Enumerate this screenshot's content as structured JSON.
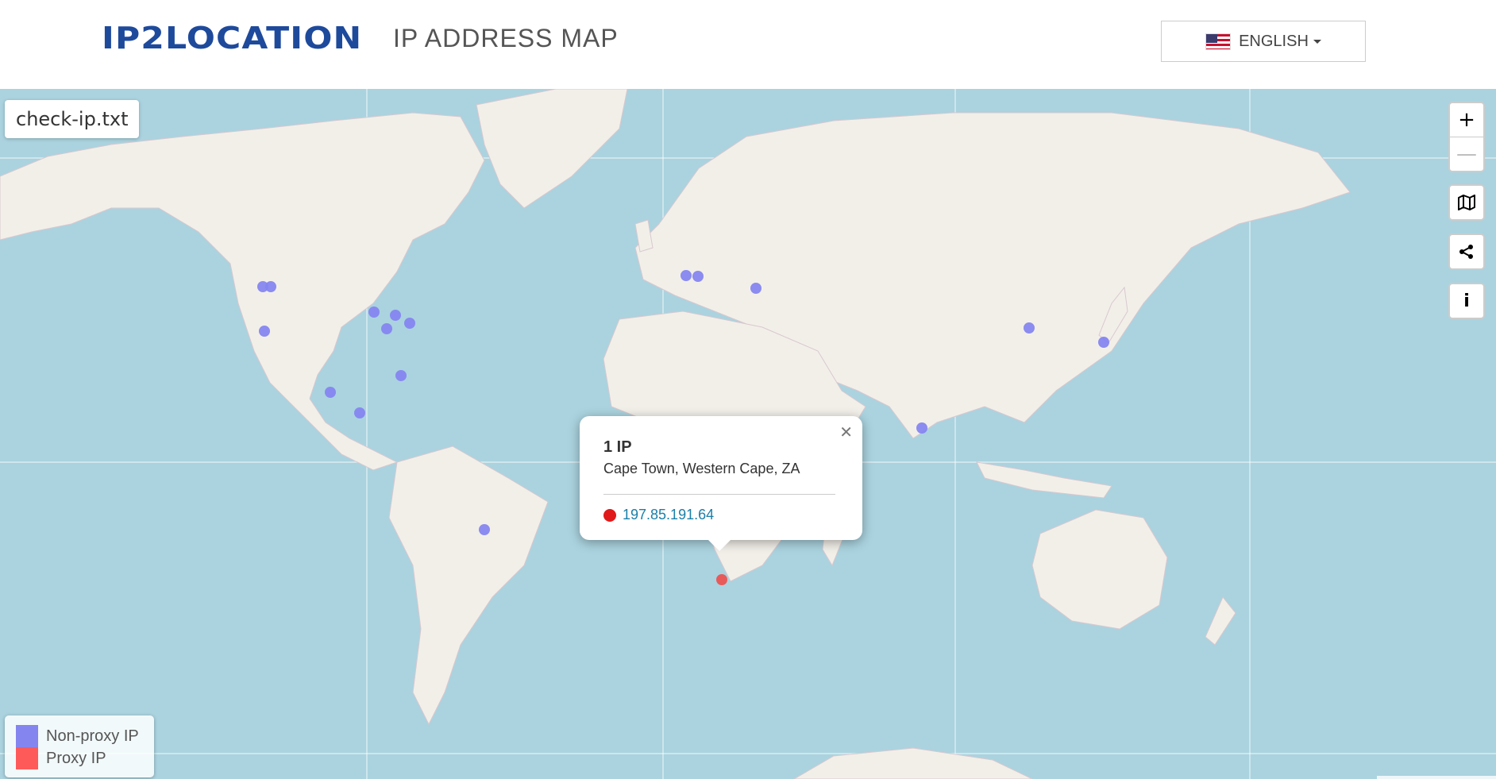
{
  "header": {
    "logo": "IP2LOCATION",
    "title": "IP ADDRESS MAP",
    "language": "ENGLISH"
  },
  "map": {
    "file_label": "check-ip.txt",
    "controls": {
      "zoom_in": "+",
      "zoom_out": "—",
      "info": "i"
    },
    "popup": {
      "count": "1 IP",
      "location": "Cape Town, Western Cape, ZA",
      "ip": "197.85.191.64"
    },
    "legend": {
      "non_proxy": "Non-proxy IP",
      "proxy": "Proxy IP"
    },
    "colors": {
      "non_proxy": "#8585f0",
      "proxy": "#e85a5a",
      "water": "#aad3df",
      "land": "#f2efe9"
    }
  }
}
